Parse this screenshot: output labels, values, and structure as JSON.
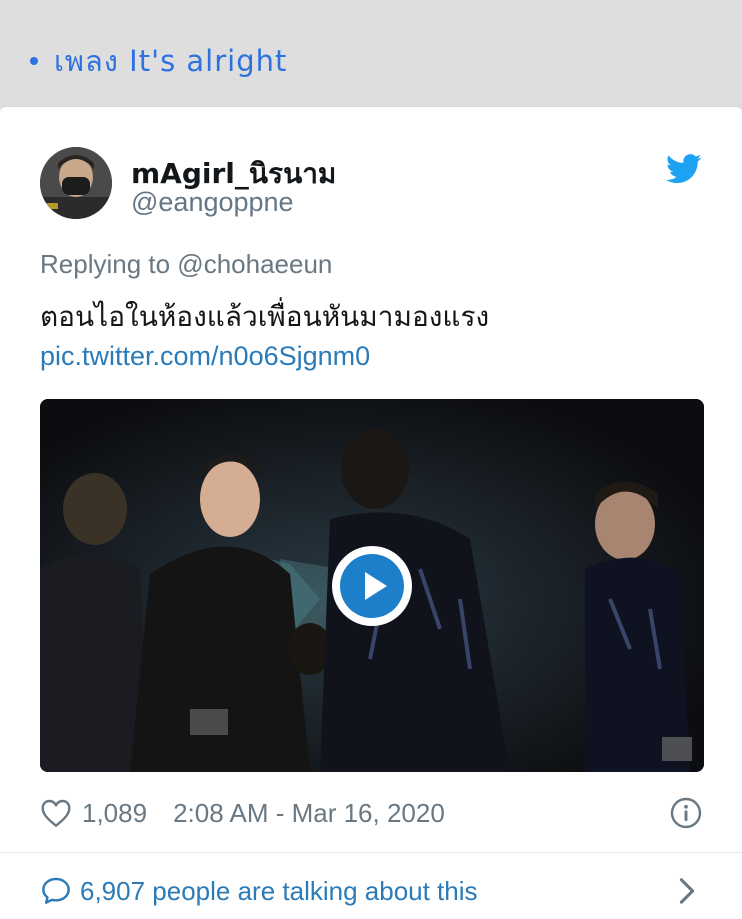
{
  "header": {
    "bullet_text": "เพลง It's alright"
  },
  "tweet": {
    "display_name": "mAgirl_นิรนาม",
    "handle": "@eangoppne",
    "reply_line": "Replying to @chohaeeun",
    "text": "ตอนไอในห้องแล้วเพื่อนหันมามองแรง",
    "link": "pic.twitter.com/n0o6Sjgnm0",
    "likes": "1,089",
    "timestamp": "2:08 AM - Mar 16, 2020",
    "talking": "6,907 people are talking about this"
  },
  "icons": {
    "twitter": "twitter-bird-icon",
    "heart": "heart-icon",
    "info": "info-icon",
    "bubble": "speech-bubble-icon",
    "chevron": "chevron-right-icon",
    "play": "play-icon"
  },
  "colors": {
    "accent": "#2e72e0",
    "link": "#2b7bb9",
    "twitter_blue": "#1da1f2",
    "muted": "#697882"
  }
}
